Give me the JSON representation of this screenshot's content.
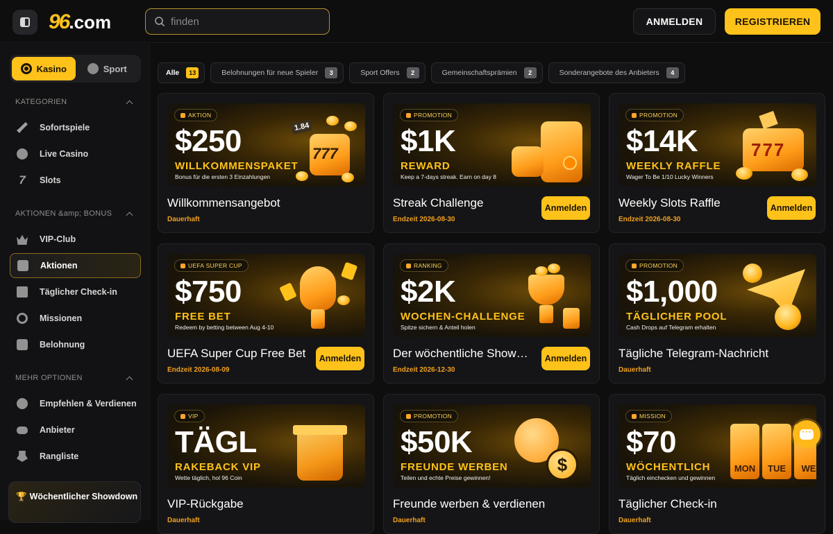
{
  "header": {
    "logo_num": "96",
    "logo_tld": ".com",
    "search_placeholder": "finden",
    "login_label": "ANMELDEN",
    "register_label": "REGISTRIEREN"
  },
  "sidebar": {
    "modes": [
      {
        "label": "Kasino",
        "icon": "casino-chip-icon",
        "active": true
      },
      {
        "label": "Sport",
        "icon": "soccer-ball-icon",
        "active": false
      }
    ],
    "sections": [
      {
        "title": "KATEGORIEN",
        "items": [
          {
            "label": "Sofortspiele",
            "icon": "rocket-icon"
          },
          {
            "label": "Live Casino",
            "icon": "live-chip-icon"
          },
          {
            "label": "Slots",
            "icon": "seven-icon"
          }
        ]
      },
      {
        "title": "AKTIONEN &amp; BONUS",
        "items": [
          {
            "label": "VIP-Club",
            "icon": "crown-icon"
          },
          {
            "label": "Aktionen",
            "icon": "gift-icon",
            "active": true
          },
          {
            "label": "Täglicher Check-in",
            "icon": "calendar-icon"
          },
          {
            "label": "Missionen",
            "icon": "target-icon"
          },
          {
            "label": "Belohnung",
            "icon": "reward-box-icon"
          }
        ]
      },
      {
        "title": "MEHR OPTIONEN",
        "items": [
          {
            "label": "Empfehlen & Verdienen",
            "icon": "coin-icon"
          },
          {
            "label": "Anbieter",
            "icon": "gamepad-icon"
          },
          {
            "label": "Rangliste",
            "icon": "medal-icon"
          }
        ]
      }
    ],
    "showdown_label": "Wöchentlicher Showdown"
  },
  "filters": [
    {
      "label": "Alle",
      "count": "13",
      "active": true
    },
    {
      "label": "Belohnungen für neue Spieler",
      "count": "3"
    },
    {
      "label": "Sport Offers",
      "count": "2"
    },
    {
      "label": "Gemeinschaftsprämien",
      "count": "2"
    },
    {
      "label": "Sonderangebote des Anbieters",
      "count": "4"
    }
  ],
  "cards": [
    {
      "tag": "AKTION",
      "amount": "$250",
      "subtitle": "WILLKOMMENSPAKET",
      "desc": "Bonus für die ersten 3 Einzahlungen",
      "title": "Willkommensangebot",
      "meta": "Dauerhaft",
      "join": ""
    },
    {
      "tag": "PROMOTION",
      "amount": "$1K",
      "subtitle": "REWARD",
      "desc": "Keep a 7-days streak. Earn on day 8",
      "title": "Streak Challenge",
      "meta": "Endzeit 2026-08-30",
      "join": "Anmelden"
    },
    {
      "tag": "PROMOTION",
      "amount": "$14K",
      "subtitle": "WEEKLY RAFFLE",
      "desc": "Wager To Be 1/10 Lucky Winners",
      "title": "Weekly Slots Raffle",
      "meta": "Endzeit 2026-08-30",
      "join": "Anmelden"
    },
    {
      "tag": "UEFA SUPER CUP",
      "amount": "$750",
      "subtitle": "FREE BET",
      "desc": "Redeem by betting between Aug 4-10",
      "title": "UEFA Super Cup Free Bet",
      "meta": "Endzeit 2026-08-09",
      "join": "Anmelden"
    },
    {
      "tag": "RANKING",
      "amount": "$2K",
      "subtitle": "WOCHEN-CHALLENGE",
      "desc": "Spitze sichern & Anteil holen",
      "title": "Der wöchentliche Showdown",
      "meta": "Endzeit 2026-12-30",
      "join": "Anmelden"
    },
    {
      "tag": "PROMOTION",
      "amount": "$1,000",
      "subtitle": "TÄGLICHER POOL",
      "desc": "Cash Drops auf Telegram erhalten",
      "title": "Tägliche Telegram-Nachricht",
      "meta": "Dauerhaft",
      "join": ""
    },
    {
      "tag": "VIP",
      "amount": "TÄGL",
      "subtitle": "RAKEBACK VIP",
      "desc": "Wette täglich, hol 96 Coin",
      "title": "VIP-Rückgabe",
      "meta": "Dauerhaft",
      "join": ""
    },
    {
      "tag": "PROMOTION",
      "amount": "$50K",
      "subtitle": "FREUNDE WERBEN",
      "desc": "Teilen und echte Preise gewinnen!",
      "title": "Freunde werben & verdienen",
      "meta": "Dauerhaft",
      "join": ""
    },
    {
      "tag": "MISSION",
      "amount": "$70",
      "subtitle": "WÖCHENTLICH",
      "desc": "Täglich einchecken und gewinnen",
      "title": "Täglicher Check-in",
      "meta": "Dauerhaft",
      "join": ""
    }
  ],
  "art_text": {
    "slot_777": "777",
    "odds": "1.84",
    "days": [
      "MON",
      "TUE",
      "WE"
    ]
  },
  "colors": {
    "accent": "#ffc21a",
    "background": "#0e0e0f",
    "panel": "#151517",
    "meta": "#f0a020"
  }
}
